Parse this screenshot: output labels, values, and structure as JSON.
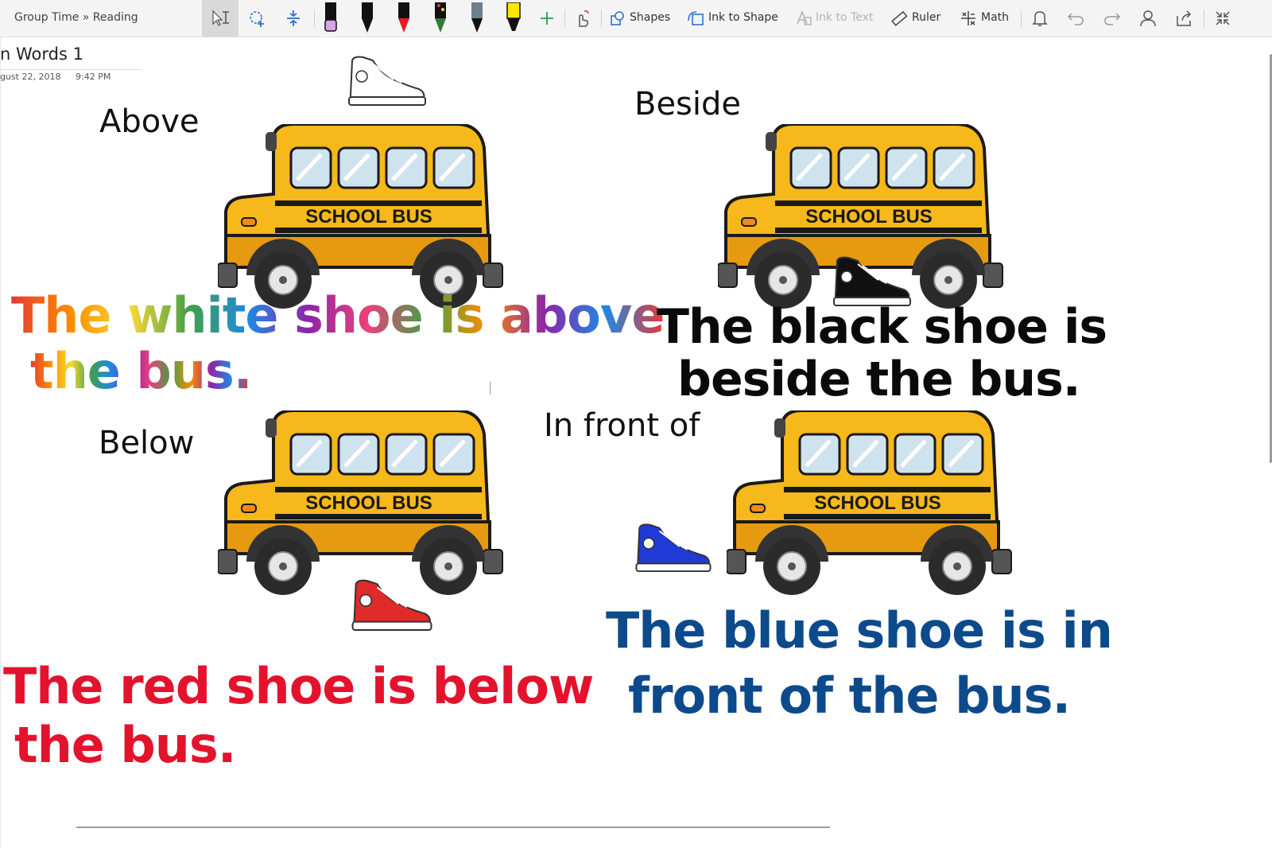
{
  "app": {
    "breadcrumb": "Group Time » Reading"
  },
  "toolbar": {
    "tools": [
      {
        "name": "lasso-text-select",
        "icon": "text-select-icon"
      },
      {
        "name": "lasso-select",
        "icon": "lasso-icon"
      },
      {
        "name": "add-space",
        "icon": "add-space-icon"
      }
    ],
    "pens": [
      {
        "color": "#d9a3e4",
        "type": "eraser"
      },
      {
        "color": "#111111",
        "type": "pen"
      },
      {
        "color": "#e21b26",
        "type": "pen"
      },
      {
        "color": "#2e7d32",
        "type": "galaxy-pen"
      },
      {
        "color": "#6d7f8a",
        "type": "pencil"
      },
      {
        "color": "#ffe600",
        "type": "highlighter"
      }
    ],
    "shapes_label": "Shapes",
    "ink_to_shape_label": "Ink to Shape",
    "ink_to_text_label": "Ink to Text",
    "ruler_label": "Ruler",
    "math_label": "Math"
  },
  "page": {
    "title": "n Words 1",
    "date": "gust 22, 2018",
    "time": "9:42 PM"
  },
  "quadrants": {
    "above": {
      "heading": "Above",
      "sentence_line1": "The white shoe is above",
      "sentence_line2": "the bus.",
      "shoe_color": "#ffffff",
      "ink_color": "rainbow-glitter"
    },
    "beside": {
      "heading": "Beside",
      "sentence_line1": "The black shoe is",
      "sentence_line2": "beside the bus.",
      "shoe_color": "#111111",
      "ink_color": "#0a0a0a"
    },
    "below": {
      "heading": "Below",
      "sentence_line1": "The red shoe is below",
      "sentence_line2": "the bus.",
      "shoe_color": "#e12a2a",
      "ink_color": "#e3132d"
    },
    "in_front": {
      "heading": "In front of",
      "sentence_line1": "The blue shoe is in",
      "sentence_line2": "front of the bus.",
      "shoe_color": "#1f3ad6",
      "ink_color": "#0d4a8c"
    }
  },
  "bus_label": "SCHOOL BUS",
  "colors": {
    "bus_yellow": "#f6b81a",
    "bus_dark": "#e69a10",
    "window": "#cfe3ef",
    "toolbar_bg": "#f4f4f4"
  }
}
